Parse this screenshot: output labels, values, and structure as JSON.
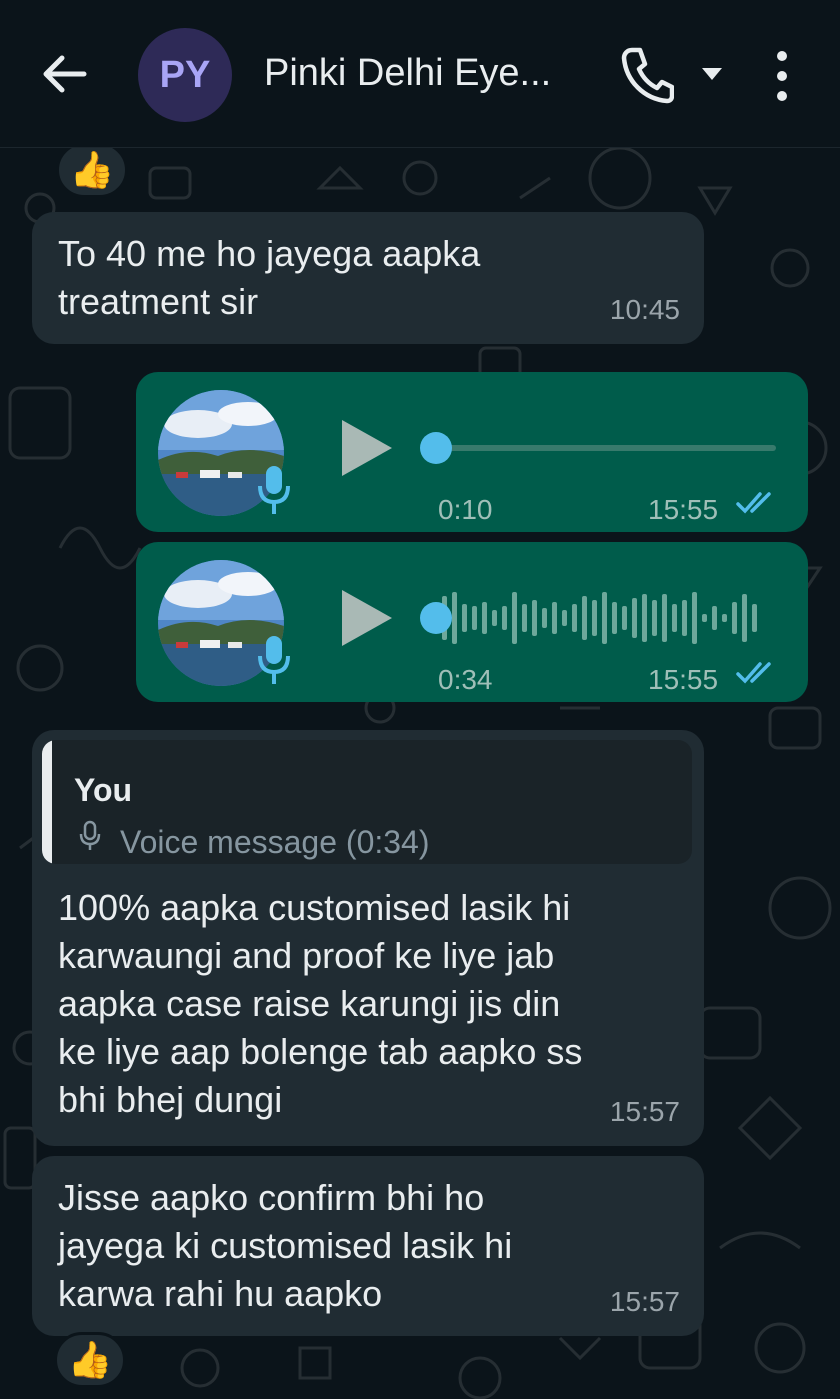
{
  "header": {
    "avatar_initials": "PY",
    "contact_name": "Pinki Delhi Eye..."
  },
  "reactions": {
    "emoji": "👍"
  },
  "messages": [
    {
      "direction": "incoming",
      "text": "To 40 me ho jayega aapka\ntreatment sir",
      "time": "10:45"
    },
    {
      "direction": "outgoing",
      "type": "voice",
      "duration": "0:10",
      "time": "15:55",
      "status": "read",
      "played": false
    },
    {
      "direction": "outgoing",
      "type": "voice",
      "duration": "0:34",
      "time": "15:55",
      "status": "read",
      "played": true
    },
    {
      "direction": "incoming",
      "reply_to": {
        "author": "You",
        "preview": "Voice message (0:34)"
      },
      "text": "100% aapka customised lasik hi\nkarwaungi and proof ke liye jab\naapka case raise karungi jis din\nke liye aap bolenge tab aapko ss\nbhi bhej dungi",
      "time": "15:57"
    },
    {
      "direction": "incoming",
      "text": "Jisse aapko confirm bhi ho\njayega ki customised lasik hi\nkarwa rahi hu aapko",
      "time": "15:57"
    }
  ],
  "colors": {
    "background": "#0b141a",
    "incoming_bubble": "#202c33",
    "outgoing_bubble": "#005c4b",
    "accent_blue": "#53bdeb",
    "avatar_bg": "#2e2a57",
    "avatar_text": "#a9a5f6"
  },
  "icons": {
    "back": "arrow-left-icon",
    "call": "phone-icon",
    "call_options": "caret-down-icon",
    "menu": "more-vertical-icon",
    "read_receipt": "double-check-icon",
    "voice_mic": "mic-icon",
    "play": "play-icon"
  }
}
